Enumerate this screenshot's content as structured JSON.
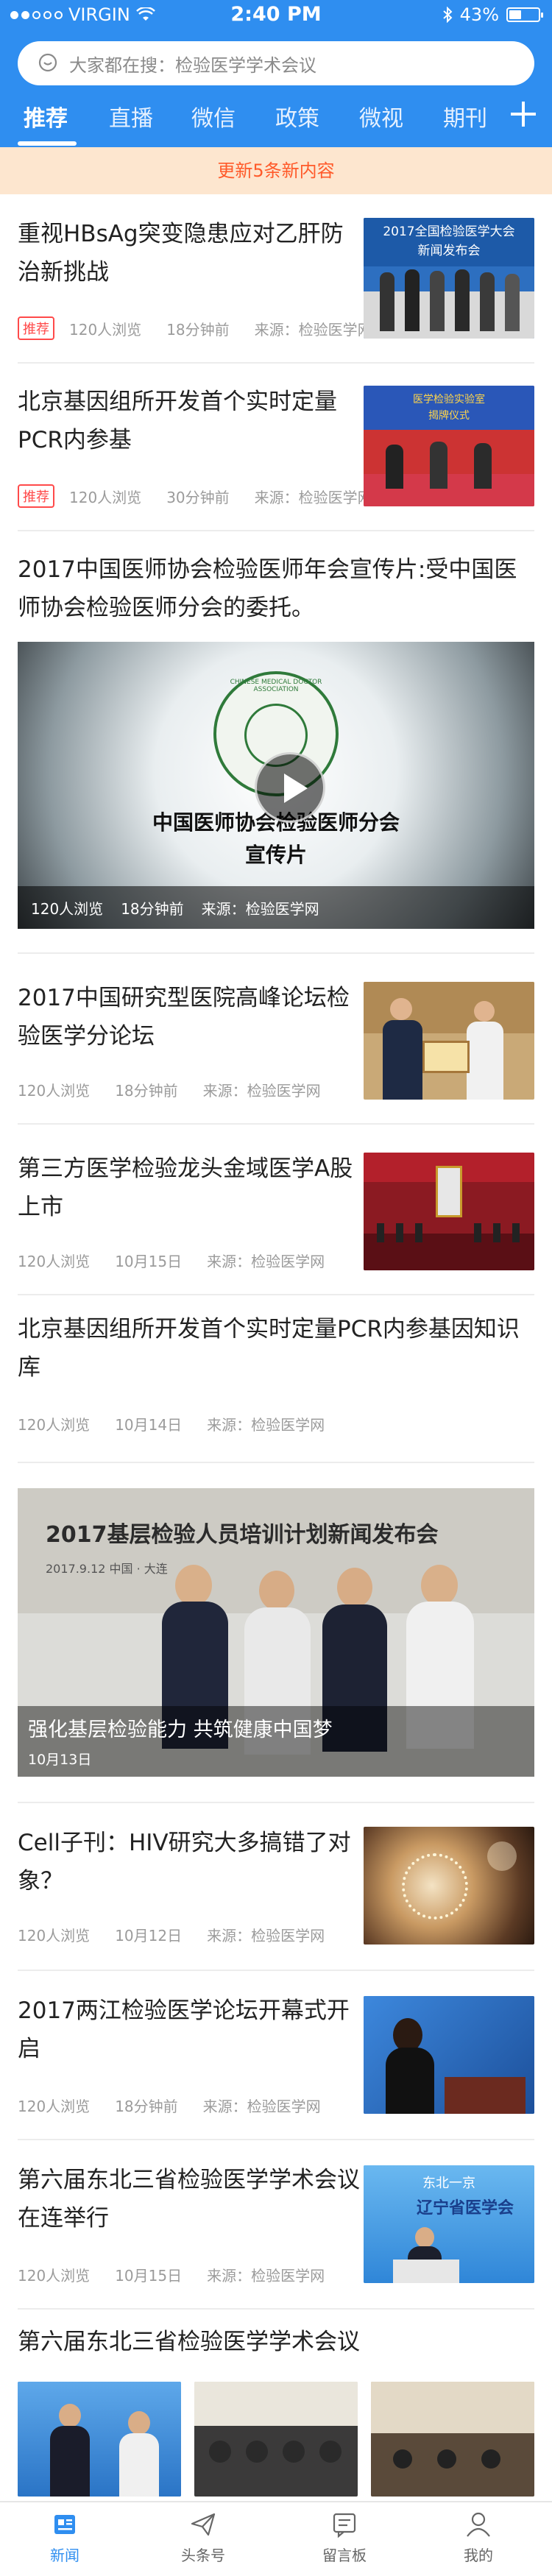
{
  "status_bar": {
    "carrier": "VIRGIN",
    "time": "2:40 PM",
    "battery": "43%",
    "battery_level": 0.43
  },
  "search": {
    "placeholder": "大家都在搜：检验医学学术会议"
  },
  "tabs": [
    {
      "label": "推荐",
      "active": true
    },
    {
      "label": "直播"
    },
    {
      "label": "微信"
    },
    {
      "label": "政策"
    },
    {
      "label": "微视"
    },
    {
      "label": "期刊"
    }
  ],
  "notice": "更新5条新内容",
  "articles": [
    {
      "title": "重视HBsAg突变隐患应对乙肝防治新挑战",
      "tag": "推荐",
      "views": "120人浏览",
      "time": "18分钟前",
      "source": "来源：检验医学网",
      "thumb_text": [
        "2017全国检验医学大会",
        "新闻发布会"
      ]
    },
    {
      "title": "北京基因组所开发首个实时定量PCR内参基",
      "tag": "推荐",
      "views": "120人浏览",
      "time": "30分钟前",
      "source": "来源：检验医学网",
      "thumb_text": [
        "医学检验实验室",
        "揭牌仪式"
      ]
    },
    {
      "title": "2017中国医师协会检验医师年会宣传片:受中国医师协会检验医师分会的委托。",
      "views": "120人浏览",
      "time": "18分钟前",
      "source": "来源：检验医学网",
      "video_text": [
        "中国医师协会检验医师分会",
        "宣传片"
      ],
      "seal_text": "CHINESE MEDICAL DOCTOR ASSOCIATION"
    },
    {
      "title": "2017中国研究型医院高峰论坛检验医学分论坛",
      "views": "120人浏览",
      "time": "18分钟前",
      "source": "来源：检验医学网"
    },
    {
      "title": "第三方医学检验龙头金域医学A股上市",
      "views": "120人浏览",
      "time": "10月15日",
      "source": "来源：检验医学网"
    },
    {
      "title": "北京基因组所开发首个实时定量PCR内参基因知识库",
      "views": "120人浏览",
      "time": "10月14日",
      "source": "来源：检验医学网"
    },
    {
      "title": "强化基层检验能力 共筑健康中国梦",
      "time": "10月13日",
      "banner": "2017基层检验人员培训计划新闻发布会",
      "banner_sub": "2017.9.12  中国 · 大连"
    },
    {
      "title": "Cell子刊：HIV研究大多搞错了对象？",
      "views": "120人浏览",
      "time": "10月12日",
      "source": "来源：检验医学网"
    },
    {
      "title": "2017两江检验医学论坛开幕式开启",
      "views": "120人浏览",
      "time": "18分钟前",
      "source": "来源：检验医学网"
    },
    {
      "title": "第六届东北三省检验医学学术会议在连举行",
      "views": "120人浏览",
      "time": "10月15日",
      "source": "来源：检验医学网",
      "thumb_text": [
        "东北一京",
        "辽宁省医学会"
      ]
    }
  ],
  "gallery": {
    "title": "第六届东北三省检验医学学术会议"
  },
  "bottom_nav": [
    {
      "label": "新闻",
      "icon": "news-icon",
      "active": true
    },
    {
      "label": "头条号",
      "icon": "paper-plane-icon"
    },
    {
      "label": "留言板",
      "icon": "message-board-icon"
    },
    {
      "label": "我的",
      "icon": "user-icon"
    }
  ],
  "colors": {
    "brand": "#2f8ef0",
    "notice_bg": "#fde6cf",
    "notice_text": "#ff5a2a",
    "tag": "#ff4a4a"
  }
}
